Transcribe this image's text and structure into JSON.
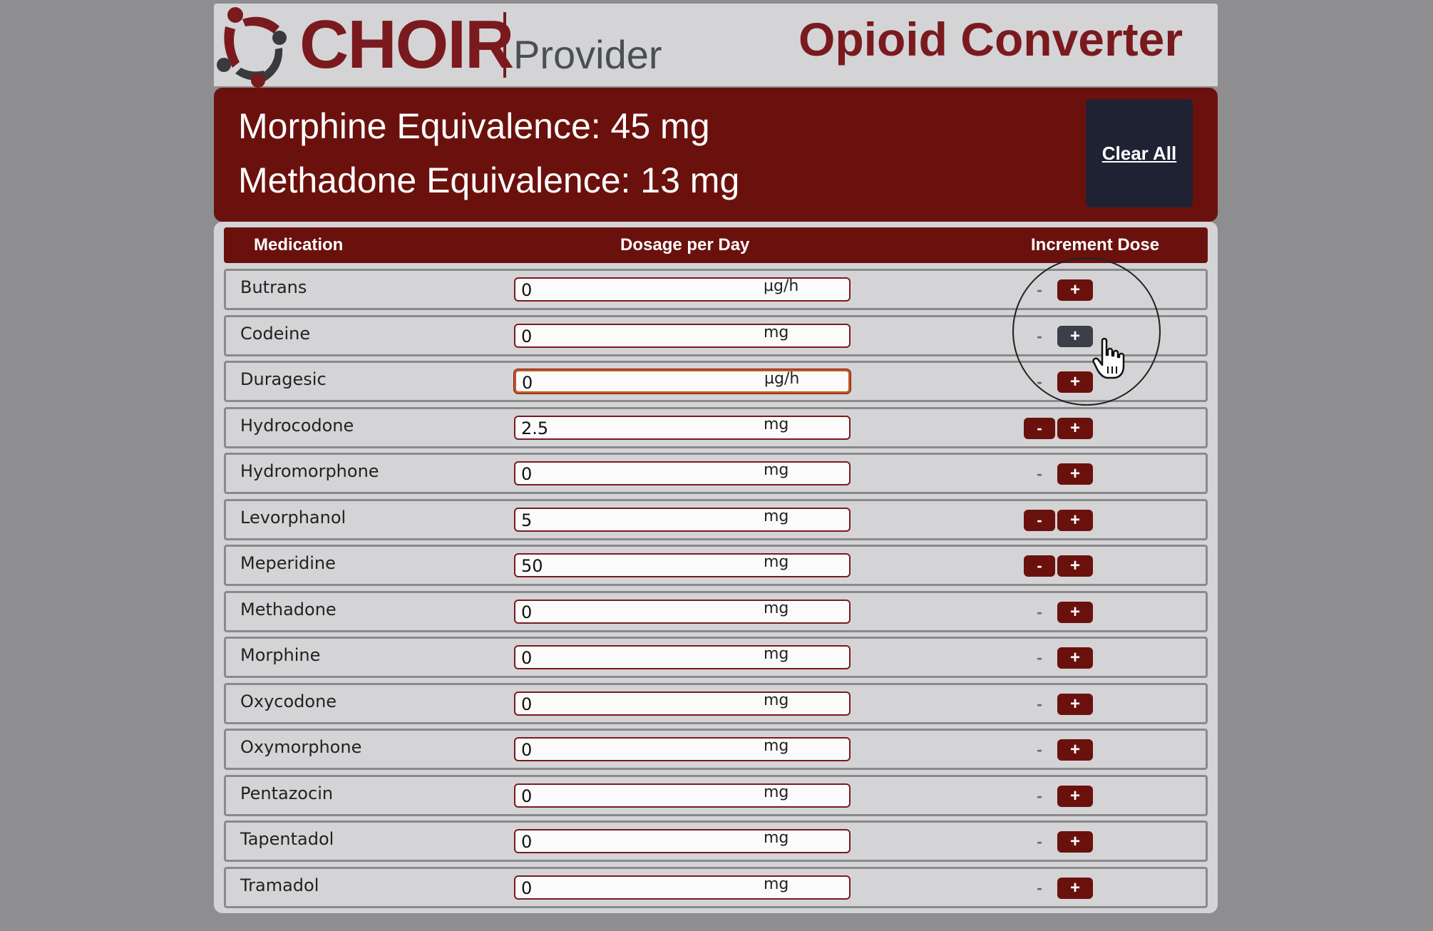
{
  "header": {
    "logo_text": "CHOIR",
    "logo_sub": "Provider",
    "title": "Opioid Converter"
  },
  "summary": {
    "morphine": "Morphine Equivalence: 45 mg",
    "methadone": "Methadone Equivalence: 13 mg",
    "clear_label": "Clear All"
  },
  "table": {
    "headers": {
      "medication": "Medication",
      "dosage": "Dosage per Day",
      "increment": "Increment Dose"
    },
    "rows": [
      {
        "name": "Butrans",
        "value": "0",
        "unit": "µg/h",
        "minus": "-",
        "plus": "+"
      },
      {
        "name": "Codeine",
        "value": "0",
        "unit": "mg",
        "minus": "-",
        "plus": "+"
      },
      {
        "name": "Duragesic",
        "value": "0",
        "unit": "µg/h",
        "minus": "-",
        "plus": "+"
      },
      {
        "name": "Hydrocodone",
        "value": "2.5",
        "unit": "mg",
        "minus": "-",
        "plus": "+"
      },
      {
        "name": "Hydromorphone",
        "value": "0",
        "unit": "mg",
        "minus": "-",
        "plus": "+"
      },
      {
        "name": "Levorphanol",
        "value": "5",
        "unit": "mg",
        "minus": "-",
        "plus": "+"
      },
      {
        "name": "Meperidine",
        "value": "50",
        "unit": "mg",
        "minus": "-",
        "plus": "+"
      },
      {
        "name": "Methadone",
        "value": "0",
        "unit": "mg",
        "minus": "-",
        "plus": "+"
      },
      {
        "name": "Morphine",
        "value": "0",
        "unit": "mg",
        "minus": "-",
        "plus": "+"
      },
      {
        "name": "Oxycodone",
        "value": "0",
        "unit": "mg",
        "minus": "-",
        "plus": "+"
      },
      {
        "name": "Oxymorphone",
        "value": "0",
        "unit": "mg",
        "minus": "-",
        "plus": "+"
      },
      {
        "name": "Pentazocin",
        "value": "0",
        "unit": "mg",
        "minus": "-",
        "plus": "+"
      },
      {
        "name": "Tapentadol",
        "value": "0",
        "unit": "mg",
        "minus": "-",
        "plus": "+"
      },
      {
        "name": "Tramadol",
        "value": "0",
        "unit": "mg",
        "minus": "-",
        "plus": "+"
      }
    ]
  },
  "colors": {
    "brand": "#7a1a1f",
    "banner": "#6b110d",
    "button_dark": "#1f2233"
  }
}
